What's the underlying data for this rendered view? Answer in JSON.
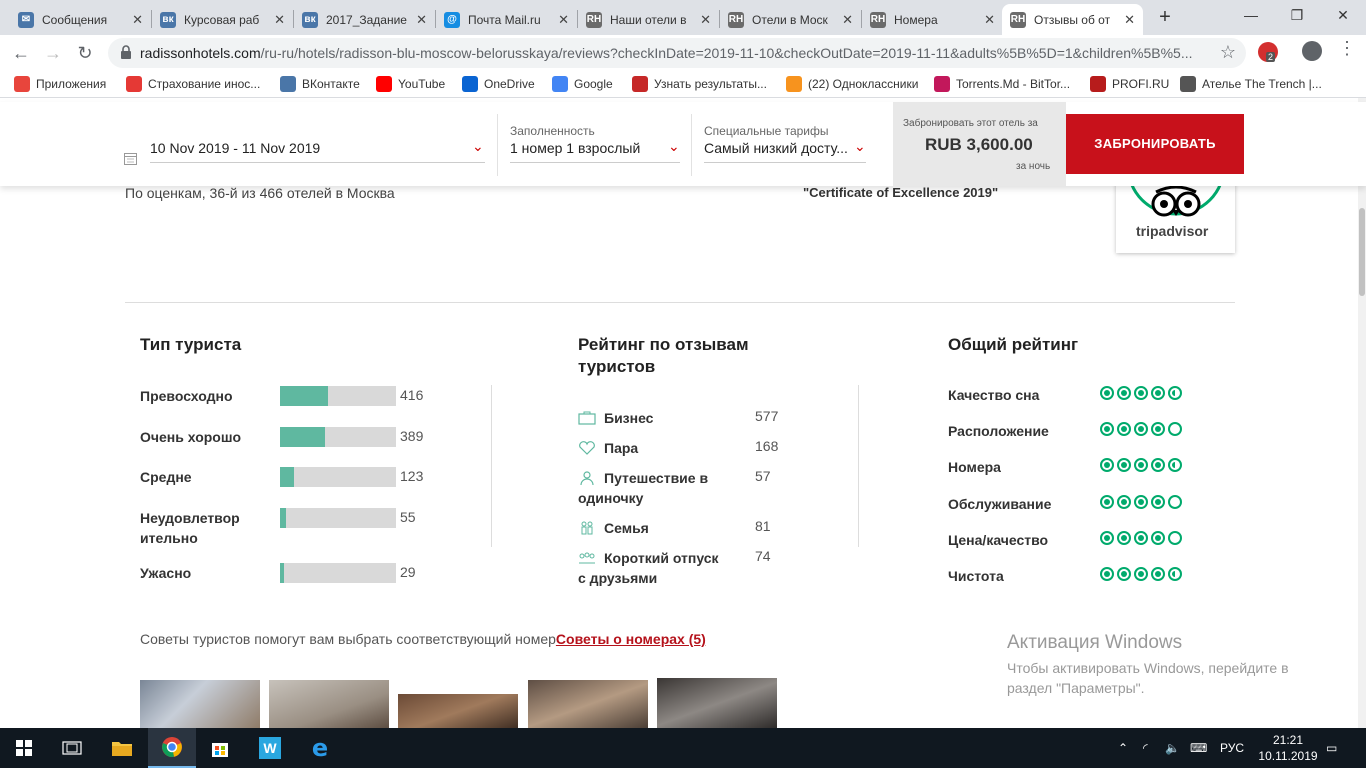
{
  "browser": {
    "tabs": [
      {
        "title": "Сообщения",
        "icon": "vk-messages-icon",
        "color": "#4a76a8",
        "glyph": "✉"
      },
      {
        "title": "Курсовая раб",
        "icon": "vk-icon",
        "color": "#4a76a8",
        "glyph": "вк"
      },
      {
        "title": "2017_Задание",
        "icon": "vk-icon",
        "color": "#4a76a8",
        "glyph": "вк"
      },
      {
        "title": "Почта Mail.ru",
        "icon": "mailru-icon",
        "color": "#168de2",
        "glyph": "@"
      },
      {
        "title": "Наши отели в",
        "icon": "radisson-icon",
        "color": "#6b6b6b",
        "glyph": "RH"
      },
      {
        "title": "Отели в Моск",
        "icon": "radisson-icon",
        "color": "#6b6b6b",
        "glyph": "RH"
      },
      {
        "title": "Номера",
        "icon": "radisson-icon",
        "color": "#6b6b6b",
        "glyph": "RH"
      },
      {
        "title": "Отзывы об от",
        "icon": "radisson-icon",
        "color": "#6b6b6b",
        "glyph": "RH",
        "active": true
      }
    ],
    "url_domain": "radissonhotels.com",
    "url_rest": "/ru-ru/hotels/radisson-blu-moscow-belorusskaya/reviews?checkInDate=2019-11-10&checkOutDate=2019-11-11&adults%5B%5D=1&children%5B%5...",
    "extension_badge": "2",
    "bookmarks": [
      {
        "label": "Приложения",
        "icon": "apps-grid-icon",
        "color": "#e8453c"
      },
      {
        "label": "Страхование инос...",
        "icon": "insurance-icon",
        "color": "#e53935"
      },
      {
        "label": "ВКонтакте",
        "icon": "vk-icon",
        "color": "#4a76a8"
      },
      {
        "label": "YouTube",
        "icon": "youtube-icon",
        "color": "#ff0000"
      },
      {
        "label": "OneDrive",
        "icon": "onedrive-icon",
        "color": "#0a64d2"
      },
      {
        "label": "Google",
        "icon": "google-icon",
        "color": "#4285f4"
      },
      {
        "label": "Узнать результаты...",
        "icon": "bookmark-page-icon",
        "color": "#c62828"
      },
      {
        "label": "(22) Одноклассники",
        "icon": "odnoklassniki-icon",
        "color": "#f7931e"
      },
      {
        "label": "Torrents.Md - BitTor...",
        "icon": "torrents-icon",
        "color": "#c2185b"
      },
      {
        "label": "PROFI.RU",
        "icon": "profi-icon",
        "color": "#b71c1c"
      },
      {
        "label": "Ателье The Trench |...",
        "icon": "globe-icon",
        "color": "#555555"
      }
    ]
  },
  "booking": {
    "dates": "10 Nov 2019 - 11 Nov 2019",
    "occupancy_label": "Заполненность",
    "occupancy_value": "1 номер   1 взрослый",
    "rates_label": "Специальные тарифы",
    "rates_value": "Самый низкий досту...",
    "price_caption": "Забронировать этот отель за",
    "price": "RUB 3,600.00",
    "price_per": "за ночь",
    "book_button": "ЗАБРОНИРОВАТЬ"
  },
  "hotel": {
    "rank_text": "По оценкам, 36-й из 466 отелей в Москва",
    "certificate": "\"Certificate of Excellence 2019\"",
    "tripadvisor_logo": "tripadvisor"
  },
  "traveler_type": {
    "title": "Тип туриста",
    "rows": [
      {
        "label": "Превосходно",
        "count": "416",
        "fraction": 0.41
      },
      {
        "label": "Очень хорошо",
        "count": "389",
        "fraction": 0.39
      },
      {
        "label": "Средне",
        "count": "123",
        "fraction": 0.12
      },
      {
        "label": "Неудовлетвор ительно",
        "count": "55",
        "fraction": 0.055
      },
      {
        "label": "Ужасно",
        "count": "29",
        "fraction": 0.03
      }
    ]
  },
  "trip_rating": {
    "title": "Рейтинг по отзывам туристов",
    "rows": [
      {
        "label": "Бизнес",
        "count": "577",
        "icon": "briefcase-icon"
      },
      {
        "label": "Пара",
        "count": "168",
        "icon": "heart-icon"
      },
      {
        "label": "Путешествие в одиночку",
        "count": "57",
        "icon": "person-icon"
      },
      {
        "label": "Семья",
        "count": "81",
        "icon": "family-icon"
      },
      {
        "label": "Короткий отпуск с друзьями",
        "count": "74",
        "icon": "friends-icon"
      }
    ]
  },
  "overall_rating": {
    "title": "Общий рейтинг",
    "rows": [
      {
        "label": "Качество сна",
        "rating": 4.5
      },
      {
        "label": "Расположение",
        "rating": 4
      },
      {
        "label": "Номера",
        "rating": 4.5
      },
      {
        "label": "Обслуживание",
        "rating": 4
      },
      {
        "label": "Цена/качество",
        "rating": 4
      },
      {
        "label": "Чистота",
        "rating": 4.5
      }
    ]
  },
  "tips": {
    "text": "Советы туристов помогут вам выбрать соответствующий номер",
    "link": "Советы о номерах (5)"
  },
  "windows_activation": {
    "title": "Активация Windows",
    "subtitle": "Чтобы активировать Windows, перейдите в раздел \"Параметры\"."
  },
  "taskbar": {
    "language": "РУС",
    "time": "21:21",
    "date": "10.11.2019"
  },
  "colors": {
    "accent": "#c8111b",
    "bar_fill": "#5fb8a0",
    "tripadvisor_green": "#00aa6c"
  }
}
